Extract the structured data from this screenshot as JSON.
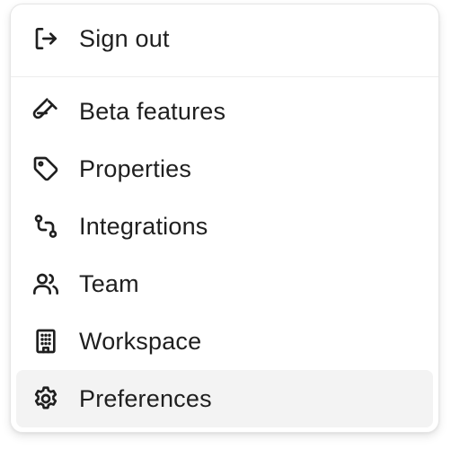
{
  "menu": {
    "sign_out": {
      "label": "Sign out",
      "icon": "log-out-icon"
    },
    "items": [
      {
        "label": "Beta features",
        "icon": "flask-icon"
      },
      {
        "label": "Properties",
        "icon": "tag-icon"
      },
      {
        "label": "Integrations",
        "icon": "integrations-icon"
      },
      {
        "label": "Team",
        "icon": "users-icon"
      },
      {
        "label": "Workspace",
        "icon": "building-icon"
      },
      {
        "label": "Preferences",
        "icon": "gear-icon",
        "active": true
      }
    ],
    "colors": {
      "text": "#1f1f1f",
      "active_background": "#f3f3f3",
      "divider": "#ececec"
    }
  }
}
